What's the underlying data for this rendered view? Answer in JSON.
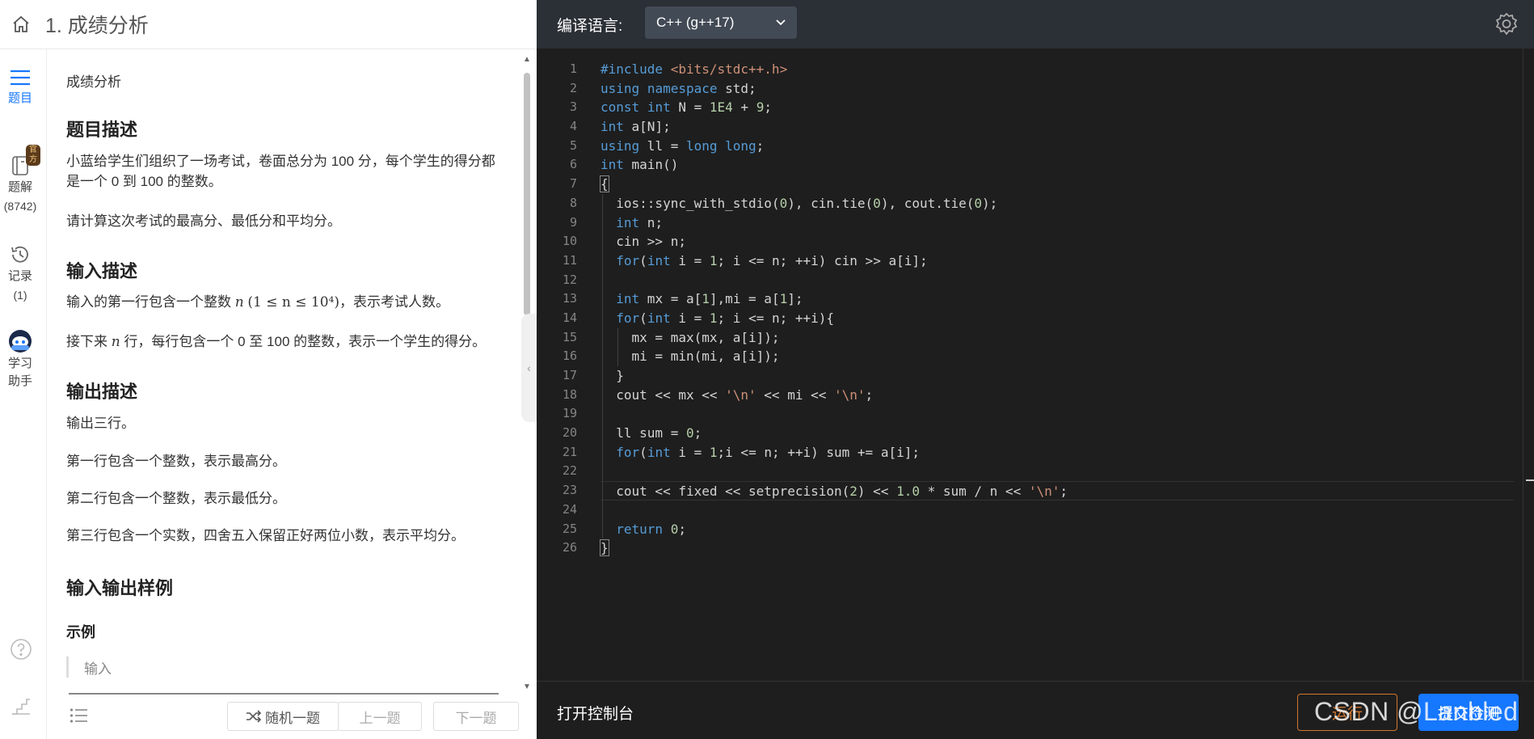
{
  "header": {
    "title": "1. 成绩分析"
  },
  "side_nav": {
    "problem": {
      "label": "题目"
    },
    "solution": {
      "label": "题解",
      "count": "(8742)",
      "badge": "官方"
    },
    "records": {
      "label": "记录",
      "count": "(1)"
    },
    "assistant": {
      "label_line1": "学习",
      "label_line2": "助手"
    }
  },
  "problem": {
    "crumb": "成绩分析",
    "desc_heading": "题目描述",
    "desc_p1": "小蓝给学生们组织了一场考试，卷面总分为 100 分，每个学生的得分都是一个 0 到 100 的整数。",
    "desc_p2": "请计算这次考试的最高分、最低分和平均分。",
    "input_heading": "输入描述",
    "input_p1_before": "输入的第一行包含一个整数 ",
    "input_p1_var": "n",
    "input_p1_math": "(1 ≤ n ≤ 10⁴)",
    "input_p1_after": "，表示考试人数。",
    "input_p2_before": "接下来 ",
    "input_p2_var": "n",
    "input_p2_after": " 行，每行包含一个 0 至 100 的整数，表示一个学生的得分。",
    "output_heading": "输出描述",
    "output_p1": "输出三行。",
    "output_p2": "第一行包含一个整数，表示最高分。",
    "output_p3": "第二行包含一个整数，表示最低分。",
    "output_p4": "第三行包含一个实数，四舍五入保留正好两位小数，表示平均分。",
    "sample_heading": "输入输出样例",
    "example_heading": "示例",
    "sample_input_label": "输入"
  },
  "footer_left": {
    "random": "随机一题",
    "prev": "上一题",
    "next": "下一题"
  },
  "editor": {
    "lang_label": "编译语言:",
    "lang_value": "C++  (g++17)",
    "line_count": 26
  },
  "footer_right": {
    "console": "打开控制台",
    "run": "运行",
    "submit": "提交检测",
    "watermark": "CSDN @Lanbled"
  },
  "icons": {
    "home": "home-icon",
    "problem": "list-icon",
    "solution": "document-icon",
    "records": "history-icon",
    "assistant": "robot-icon",
    "help": "question-icon",
    "stairs": "stairs-icon",
    "settings": "gear-icon",
    "shuffle": "shuffle-icon"
  },
  "colors": {
    "accent": "#1677ff",
    "run": "#d2772e",
    "editor_bg": "#1e1e1e",
    "header_bg": "#2b2f36"
  }
}
